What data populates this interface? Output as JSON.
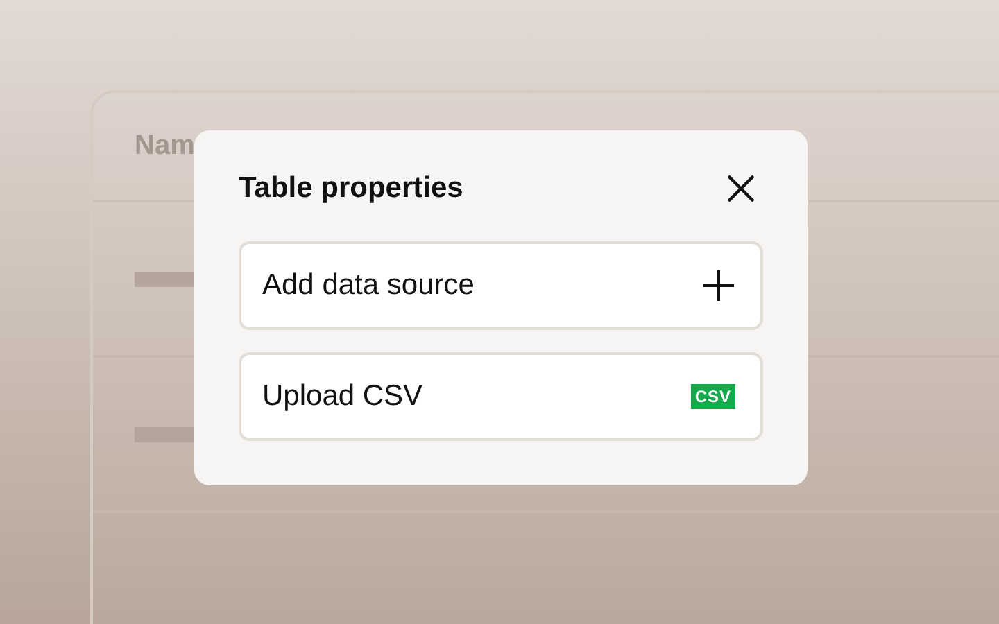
{
  "table": {
    "columns": [
      {
        "label": "Nam"
      }
    ]
  },
  "dialog": {
    "title": "Table properties",
    "options": [
      {
        "label": "Add data source",
        "kind": "add"
      },
      {
        "label": "Upload CSV",
        "kind": "csv",
        "badge": "CSV"
      }
    ]
  }
}
